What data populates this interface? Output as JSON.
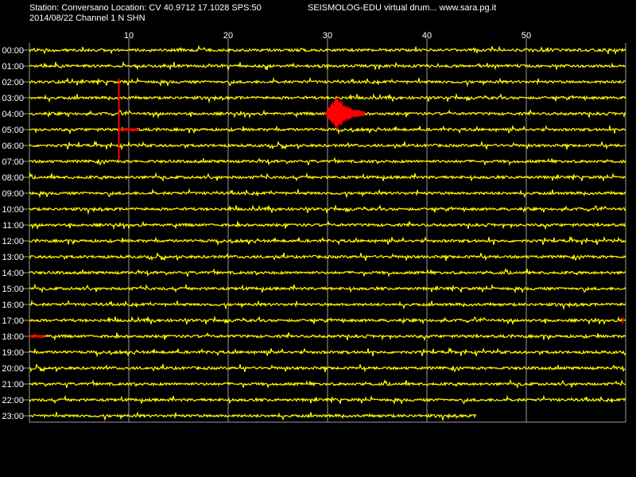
{
  "header": {
    "station_line": "Station: Conversano Location: CV 40.9712 17.1028 SPS:50",
    "date_line": "2014/08/22  Channel 1 N SHN",
    "app_line": "SEISMOLOG-EDU virtual drum... www.sara.pg.it"
  },
  "colors": {
    "background": "#000000",
    "trace": "#ffff00",
    "event": "#ff0000",
    "grid": "#9a9a9a",
    "text": "#ffffff"
  },
  "chart_data": {
    "type": "line",
    "xlim": [
      0,
      60
    ],
    "x_ticks": [
      10,
      20,
      30,
      40,
      50
    ],
    "rows": [
      "00:00",
      "01:00",
      "02:00",
      "03:00",
      "04:00",
      "05:00",
      "06:00",
      "07:00",
      "08:00",
      "09:00",
      "10:00",
      "11:00",
      "12:00",
      "13:00",
      "14:00",
      "15:00",
      "16:00",
      "17:00",
      "18:00",
      "19:00",
      "20:00",
      "21:00",
      "22:00",
      "23:00"
    ],
    "last_row_end_minute": 45,
    "events": [
      {
        "row": "04:00",
        "start_minute": 29.8,
        "end_minute": 33.8,
        "peak_minute": 31,
        "kind": "burst"
      },
      {
        "row": "02:00",
        "minute": 9,
        "kind": "spike",
        "span_rows": [
          "02:00",
          "06:00"
        ]
      },
      {
        "row": "05:00",
        "start_minute": 9,
        "end_minute": 11,
        "kind": "pulse"
      },
      {
        "row": "17:00",
        "minute": 59.7,
        "kind": "spike"
      },
      {
        "row": "18:00",
        "start_minute": 0,
        "end_minute": 1.5,
        "kind": "pulse"
      }
    ]
  }
}
